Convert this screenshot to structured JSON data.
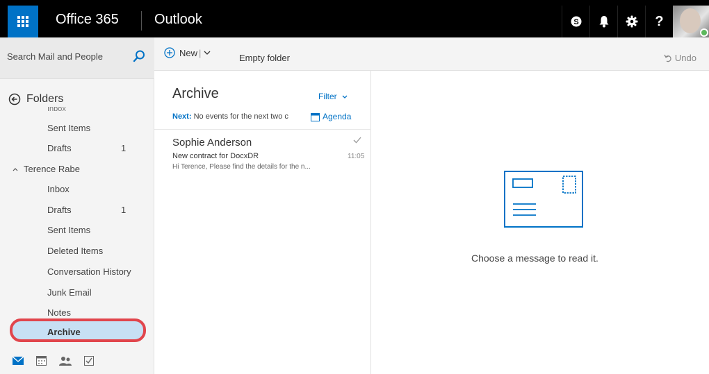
{
  "header": {
    "brand": "Office 365",
    "app_name": "Outlook",
    "icons": [
      "skype-icon",
      "bell-icon",
      "gear-icon",
      "help-icon",
      "avatar"
    ]
  },
  "search": {
    "placeholder": "Search Mail and People"
  },
  "commands": {
    "new_label": "New",
    "new_separator": "|",
    "empty_folder": "Empty folder",
    "undo": "Undo"
  },
  "folders": {
    "heading": "Folders",
    "clipped_item": "Inbox",
    "favorites": [
      {
        "label": "Sent Items",
        "count": ""
      },
      {
        "label": "Drafts",
        "count": "1"
      }
    ],
    "account_name": "Terence Rabe",
    "account_items": [
      {
        "label": "Inbox",
        "count": ""
      },
      {
        "label": "Drafts",
        "count": "1"
      },
      {
        "label": "Sent Items",
        "count": ""
      },
      {
        "label": "Deleted Items",
        "count": ""
      },
      {
        "label": "Conversation History",
        "count": ""
      },
      {
        "label": "Junk Email",
        "count": ""
      },
      {
        "label": "Notes",
        "count": ""
      }
    ],
    "selected": "Archive"
  },
  "list": {
    "title": "Archive",
    "filter": "Filter",
    "next_label": "Next:",
    "next_text": "No events for the next two c",
    "agenda": "Agenda",
    "messages": [
      {
        "sender": "Sophie Anderson",
        "subject": "New contract for DocxDR",
        "time": "11:05",
        "preview": "Hi Terence,   Please find the details for the n..."
      }
    ]
  },
  "reading": {
    "empty_message": "Choose a message to read it."
  },
  "colors": {
    "brand_blue": "#0072c6",
    "topbar": "#000000",
    "selection": "#c7e0f4",
    "highlight_ring": "#e1454c"
  }
}
